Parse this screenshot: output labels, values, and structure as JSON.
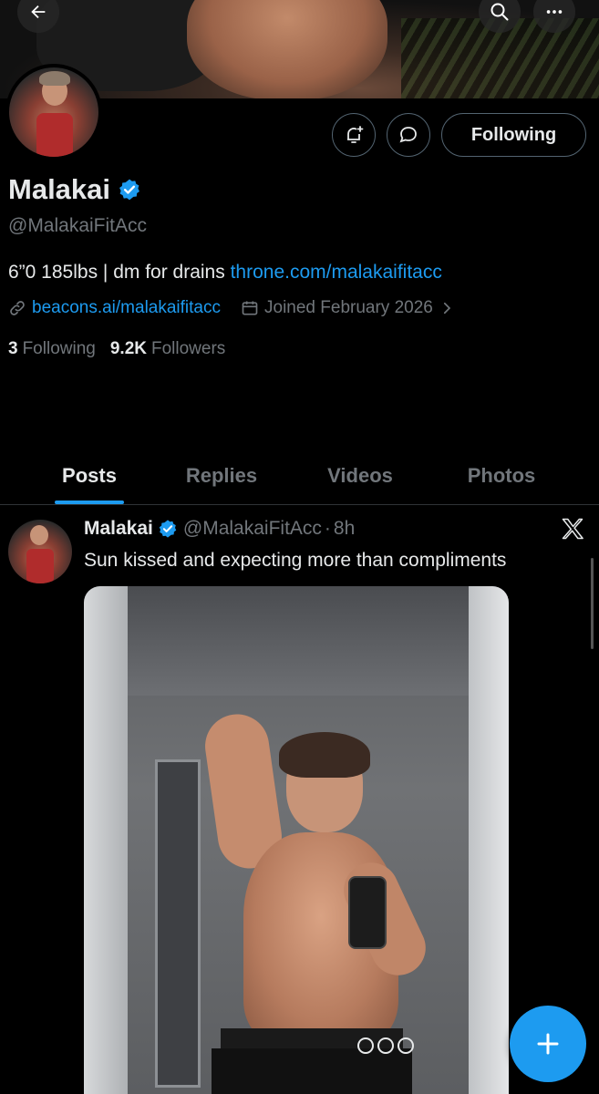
{
  "profile": {
    "display_name": "Malakai",
    "handle": "@MalakaiFitAcc",
    "bio_text": "6”0 185lbs | dm for drains ",
    "bio_link": "throne.com/malakaifitacc",
    "website": "beacons.ai/malakaifitacc",
    "joined": "Joined February 2026",
    "following_count": "3",
    "following_label": "Following",
    "followers_count": "9.2K",
    "followers_label": "Followers",
    "follow_button_label": "Following"
  },
  "tabs": [
    {
      "label": "Posts",
      "active": true
    },
    {
      "label": "Replies",
      "active": false
    },
    {
      "label": "Videos",
      "active": false
    },
    {
      "label": "Photos",
      "active": false
    }
  ],
  "post": {
    "author_name": "Malakai",
    "author_handle": "@MalakaiFitAcc",
    "separator": "·",
    "time": "8h",
    "text": "Sun kissed and expecting more than compliments"
  },
  "icons": {
    "back": "arrow-left-icon",
    "search": "search-icon",
    "more": "more-dots-icon",
    "notify": "bell-plus-icon",
    "message": "message-bubble-icon",
    "verified": "verified-badge-icon",
    "link": "link-icon",
    "calendar": "calendar-icon",
    "chevron": "chevron-right-icon",
    "x_logo": "x-logo-icon",
    "compose": "plus-icon"
  },
  "colors": {
    "background": "#000000",
    "accent": "#1d9bf0",
    "text_primary": "#e7e9ea",
    "text_secondary": "#71767b",
    "border": "#536471"
  }
}
